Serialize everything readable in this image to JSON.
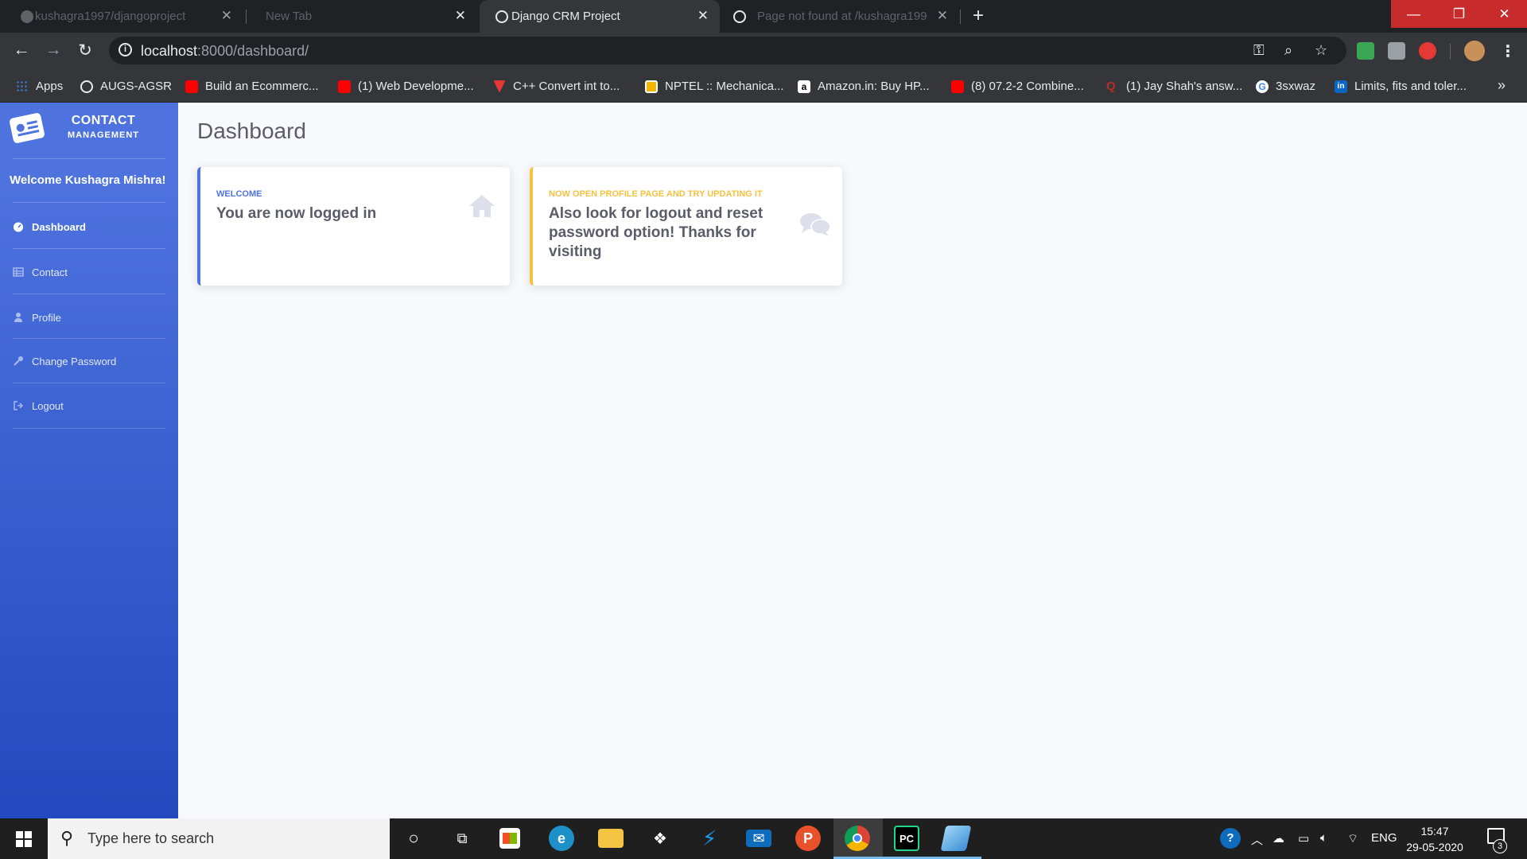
{
  "browser": {
    "tabs": [
      {
        "title": "kushagra1997/djangoproject",
        "favicon": "github-icon",
        "active": false
      },
      {
        "title": "New Tab",
        "favicon": "none",
        "active": false
      },
      {
        "title": "Django CRM Project",
        "favicon": "globe-icon",
        "active": true
      },
      {
        "title": "Page not found at /kushagra199",
        "favicon": "globe-icon",
        "active": false
      }
    ],
    "new_tab_label": "+",
    "address": {
      "host": "localhost",
      "path": ":8000/dashboard/"
    },
    "bookmarks": [
      {
        "label": "Apps",
        "icon": "apps-grid-icon",
        "color": "#4285f4"
      },
      {
        "label": "AUGS-AGSR",
        "icon": "globe-icon",
        "color": "#e8eaed"
      },
      {
        "label": "Build an Ecommerc...",
        "icon": "youtube-icon",
        "color": "#ff0000"
      },
      {
        "label": "(1) Web Developme...",
        "icon": "youtube-icon",
        "color": "#ff0000"
      },
      {
        "label": "C++ Convert int to...",
        "icon": "geeks-icon",
        "color": "#e53935"
      },
      {
        "label": "NPTEL :: Mechanica...",
        "icon": "nptel-icon",
        "color": "#f4b400"
      },
      {
        "label": "Amazon.in: Buy HP...",
        "icon": "amazon-icon",
        "color": "#ffffff"
      },
      {
        "label": "(8) 07.2-2 Combine...",
        "icon": "youtube-icon",
        "color": "#ff0000"
      },
      {
        "label": "(1) Jay Shah's answ...",
        "icon": "quora-icon",
        "color": "#b92b27"
      },
      {
        "label": "3sxwaz",
        "icon": "google-icon",
        "color": "#ffffff"
      },
      {
        "label": "Limits, fits and toler...",
        "icon": "linkedin-icon",
        "color": "#0a66c2"
      }
    ],
    "bookmarks_more": "»"
  },
  "brand": {
    "line1": "CONTACT",
    "line2": "MANAGEMENT"
  },
  "welcome_text": "Welcome Kushagra Mishra!",
  "nav": [
    {
      "label": "Dashboard",
      "icon": "tachometer-icon",
      "active": true
    },
    {
      "label": "Contact",
      "icon": "table-icon",
      "active": false
    },
    {
      "label": "Profile",
      "icon": "user-icon",
      "active": false
    },
    {
      "label": "Change Password",
      "icon": "key-icon",
      "active": false
    },
    {
      "label": "Logout",
      "icon": "sign-out-icon",
      "active": false
    }
  ],
  "page_title": "Dashboard",
  "cards": [
    {
      "kicker": "WELCOME",
      "text": "You are now logged in",
      "icon": "home-icon",
      "accent": "#4e73df"
    },
    {
      "kicker": "NOW OPEN PROFILE PAGE AND TRY UPDATING IT",
      "text": "Also look for logout and reset password option! Thanks for visiting",
      "icon": "comments-icon",
      "accent": "#f6c23e"
    }
  ],
  "taskbar": {
    "search_placeholder": "Type here to search",
    "apps": [
      "cortana-icon",
      "task-view-icon",
      "store-icon",
      "edge-icon",
      "file-explorer-icon",
      "dropbox-icon",
      "visual-studio-icon",
      "mail-icon",
      "postman-icon",
      "chrome-icon",
      "pycharm-icon",
      "notepad-icon"
    ],
    "language": "ENG",
    "time": "15:47",
    "date": "29-05-2020",
    "notification_count": "3"
  },
  "colors": {
    "primary": "#4e73df",
    "warning": "#f6c23e",
    "text_gray": "#5a5c69"
  }
}
